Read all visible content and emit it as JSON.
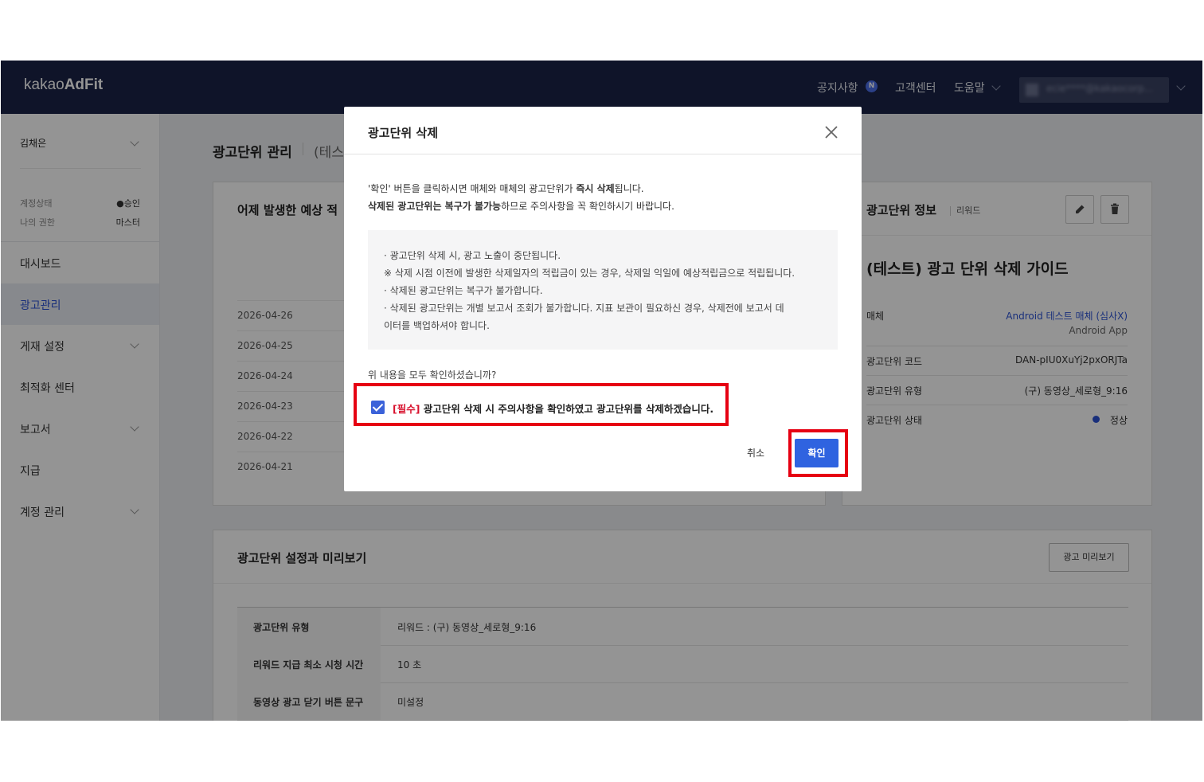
{
  "header": {
    "logo_light": "kakao",
    "logo_bold": "AdFit",
    "nav": [
      {
        "label": "공지사항"
      },
      {
        "label": "고객센터"
      },
      {
        "label": "도움말"
      }
    ],
    "notice_badge": "N",
    "user_email": "ecie****@kakaocorp..."
  },
  "sidebar": {
    "user_name": "김채은",
    "account_status_label": "계정상태",
    "account_status_value": "●승인",
    "role_label": "나의 권한",
    "role_value": "마스터",
    "items": [
      {
        "label": "대시보드"
      },
      {
        "label": "광고관리"
      },
      {
        "label": "게재 설정"
      },
      {
        "label": "최적화 센터"
      },
      {
        "label": "보고서"
      },
      {
        "label": "지급"
      },
      {
        "label": "계정 관리"
      }
    ]
  },
  "main": {
    "page_title": "광고단위 관리",
    "page_subtitle": "(테스",
    "earnings_card_title": "어제 발생한 예상 적",
    "dates": [
      "2026-04-26",
      "2026-04-25",
      "2026-04-24",
      "2026-04-23",
      "2026-04-22",
      "2026-04-21"
    ],
    "info_card": {
      "title": "광고단위 정보",
      "type_tag": "리워드",
      "unit_name": "(테스트) 광고 단위 삭제 가이드",
      "rows": [
        {
          "key": "매체",
          "value": "Android 테스트 매체 (심사X)",
          "sub": "Android App"
        },
        {
          "key": "광고단위 코드",
          "value": "DAN-pIU0XuYj2pxORJTa"
        },
        {
          "key": "광고단위 유형",
          "value": "(구) 동영상_세로형_9:16"
        },
        {
          "key": "광고단위 상태",
          "value": "정상"
        }
      ]
    },
    "settings_card": {
      "title": "광고단위 설정과 미리보기",
      "preview_button": "광고 미리보기",
      "rows": [
        {
          "key": "광고단위 유형",
          "value": "리워드 : (구) 동영상_세로형_9:16"
        },
        {
          "key": "리워드 지급 최소 시청 시간",
          "value": "10 초"
        },
        {
          "key": "동영상 광고 닫기 버튼 문구",
          "value": "미설정"
        }
      ]
    }
  },
  "modal": {
    "title": "광고단위 삭제",
    "desc1_pre": "'확인' 버튼을 클릭하시면 매체와 매체의 광고단위가 ",
    "desc1_bold": "즉시 삭제",
    "desc1_post": "됩니다.",
    "desc2_bold": "삭제된 광고단위는 복구가 불가능",
    "desc2_post": "하므로 주의사항을 꼭 확인하시기 바랍니다.",
    "notices": [
      "· 광고단위 삭제 시, 광고 노출이 중단됩니다.",
      "※ 삭제 시점 이전에 발생한 삭제일자의 적립금이 있는 경우, 삭제일 익일에 예상적립금으로 적립됩니다.",
      "· 삭제된 광고단위는 복구가 불가합니다.",
      "· 삭제된 광고단위는 개별 보고서 조회가 불가합니다. 지표 보관이 필요하신 경우, 삭제전에 보고서 데",
      "   이터를 백업하셔야 합니다."
    ],
    "question": "위 내용을 모두 확인하셨습니까?",
    "checkbox_required": "[필수]",
    "checkbox_label": " 광고단위 삭제 시 주의사항을 확인하였고 광고단위를 삭제하겠습니다.",
    "cancel_label": "취소",
    "confirm_label": "확인"
  },
  "colors": {
    "header_bg": "#1b2448",
    "accent": "#2f63e0",
    "highlight": "#e60012",
    "required": "#d8112d"
  }
}
